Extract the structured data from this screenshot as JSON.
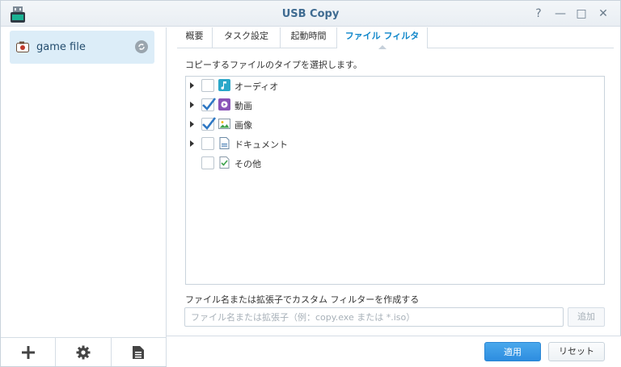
{
  "window": {
    "title": "USB Copy"
  },
  "title_buttons": [
    {
      "icon": "help-icon",
      "glyph": "?"
    },
    {
      "icon": "minimize-icon",
      "glyph": "—"
    },
    {
      "icon": "maximize-icon",
      "glyph": "□"
    },
    {
      "icon": "close-icon",
      "glyph": "✕"
    }
  ],
  "sidebar": {
    "tasks": [
      {
        "label": "game file",
        "icon": "camera-icon",
        "status_icon": "sync-icon"
      }
    ],
    "bottom_buttons": [
      {
        "icon": "add-icon"
      },
      {
        "icon": "gear-icon"
      },
      {
        "icon": "log-icon"
      }
    ]
  },
  "tabs": [
    {
      "label": "概要"
    },
    {
      "label": "タスク設定"
    },
    {
      "label": "起動時間"
    },
    {
      "label": "ファイル フィルタ",
      "active": true
    }
  ],
  "filter": {
    "section_label": "コピーするファイルのタイプを選択します。",
    "types": [
      {
        "label": "オーディオ",
        "checked": false,
        "expandable": true,
        "icon": "music-icon"
      },
      {
        "label": "動画",
        "checked": true,
        "expandable": true,
        "icon": "video-icon"
      },
      {
        "label": "画像",
        "checked": true,
        "expandable": true,
        "icon": "image-icon"
      },
      {
        "label": "ドキュメント",
        "checked": false,
        "expandable": true,
        "icon": "document-icon"
      },
      {
        "label": "その他",
        "checked": false,
        "expandable": false,
        "icon": "other-icon"
      }
    ],
    "custom_label": "ファイル名または拡張子でカスタム フィルターを作成する",
    "custom_placeholder": "ファイル名または拡張子（例：copy.exe または *.iso）",
    "add_label": "追加"
  },
  "footer": {
    "apply_label": "適用",
    "reset_label": "リセット"
  },
  "colors": {
    "accent": "#0e86ca",
    "apply": "#2d8de0",
    "selected_bg": "#dcedf8"
  }
}
